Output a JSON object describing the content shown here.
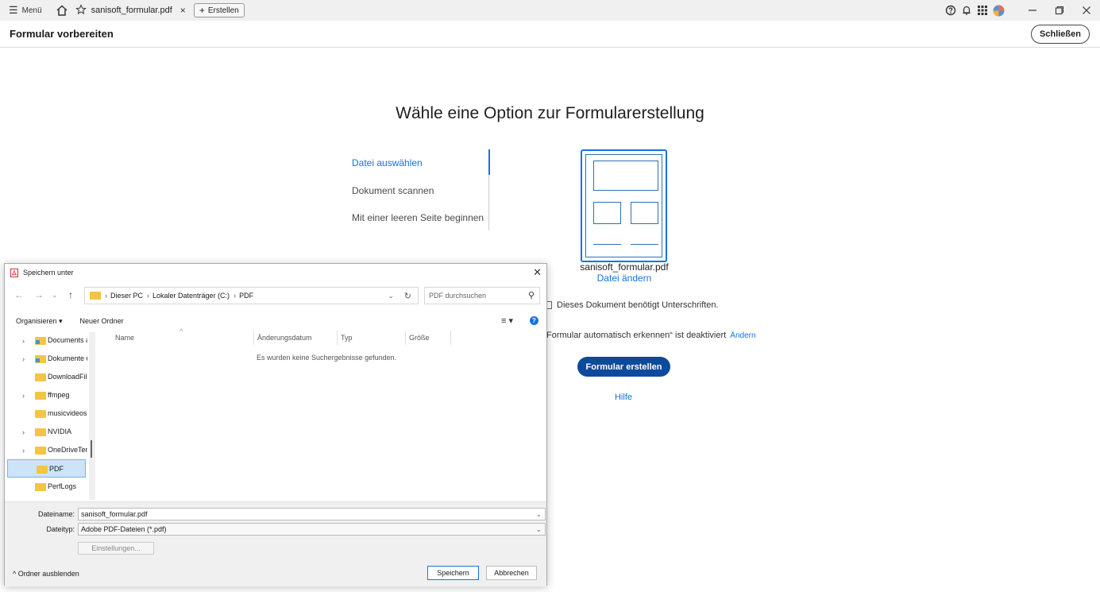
{
  "topbar": {
    "menu_label": "Menü",
    "tab_title": "sanisoft_formular.pdf",
    "tab_close": "×",
    "new_label": "Erstellen"
  },
  "header": {
    "title": "Formular vorbereiten",
    "close_label": "Schließen"
  },
  "main": {
    "heading": "Wähle eine Option zur Formularerstellung",
    "options": [
      {
        "label": "Datei auswählen",
        "active": true
      },
      {
        "label": "Dokument scannen",
        "active": false
      },
      {
        "label": "Mit einer leeren Seite beginnen",
        "active": false
      }
    ],
    "file_name": "sanisoft_formular.pdf",
    "change_file": "Datei ändern",
    "signature_label": "Dieses Dokument benötigt Unterschriften.",
    "auto_detect_text": "Formular automatisch erkennen“ ist deaktiviert",
    "auto_detect_link": "Ändern",
    "create_button": "Formular erstellen",
    "help_link": "Hilfe"
  },
  "dialog": {
    "title": "Speichern unter",
    "breadcrumb": [
      "Dieser PC",
      "Lokaler Datenträger (C:)",
      "PDF"
    ],
    "search_placeholder": "PDF durchsuchen",
    "organize": "Organisieren ▾",
    "new_folder": "Neuer Ordner",
    "tree": [
      {
        "label": "Documents a",
        "expandable": true,
        "link": true
      },
      {
        "label": "Dokumente u",
        "expandable": true,
        "link": true
      },
      {
        "label": "DownloadFile",
        "expandable": false,
        "link": false
      },
      {
        "label": "ffmpeg",
        "expandable": true,
        "link": false
      },
      {
        "label": "musicvideos",
        "expandable": false,
        "link": false
      },
      {
        "label": "NVIDIA",
        "expandable": true,
        "link": false
      },
      {
        "label": "OneDriveTem",
        "expandable": true,
        "link": false
      },
      {
        "label": "PDF",
        "expandable": false,
        "link": false,
        "selected": true
      },
      {
        "label": "PerfLogs",
        "expandable": false,
        "link": false
      }
    ],
    "columns": [
      "Name",
      "Änderungsdatum",
      "Typ",
      "Größe"
    ],
    "empty_message": "Es wurden keine Suchergebnisse gefunden.",
    "filename_label": "Dateiname:",
    "filename_value": "sanisoft_formular.pdf",
    "filetype_label": "Dateityp:",
    "filetype_value": "Adobe PDF-Dateien (*.pdf)",
    "settings_button": "Einstellungen...",
    "hide_folders": "Ordner ausblenden",
    "save_button": "Speichern",
    "cancel_button": "Abbrechen"
  },
  "colors": {
    "accent": "#1473e6",
    "primary_button": "#0d4a9c"
  }
}
